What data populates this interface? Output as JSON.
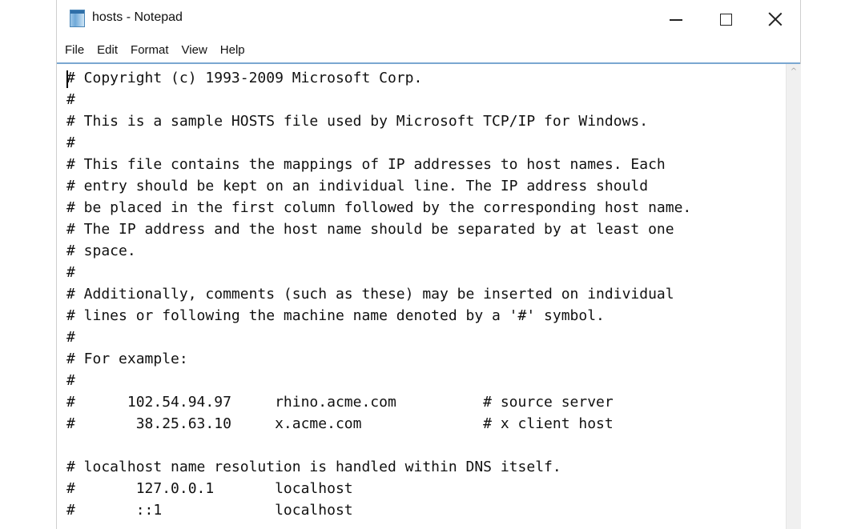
{
  "window": {
    "title": "hosts - Notepad",
    "app_icon": "notepad-icon"
  },
  "titlebar_buttons": {
    "minimize_icon": "minimize-icon",
    "maximize_icon": "maximize-icon",
    "close_icon": "close-icon"
  },
  "menu": {
    "items": [
      "File",
      "Edit",
      "Format",
      "View",
      "Help"
    ]
  },
  "editor": {
    "lines": [
      "# Copyright (c) 1993-2009 Microsoft Corp.",
      "#",
      "# This is a sample HOSTS file used by Microsoft TCP/IP for Windows.",
      "#",
      "# This file contains the mappings of IP addresses to host names. Each",
      "# entry should be kept on an individual line. The IP address should",
      "# be placed in the first column followed by the corresponding host name.",
      "# The IP address and the host name should be separated by at least one",
      "# space.",
      "#",
      "# Additionally, comments (such as these) may be inserted on individual",
      "# lines or following the machine name denoted by a '#' symbol.",
      "#",
      "# For example:",
      "#",
      "#      102.54.94.97     rhino.acme.com          # source server",
      "#       38.25.63.10     x.acme.com              # x client host",
      "",
      "# localhost name resolution is handled within DNS itself.",
      "#       127.0.0.1       localhost",
      "#       ::1             localhost"
    ]
  },
  "scrollbar": {
    "up_arrow_icon": "scroll-up-arrow-icon",
    "up_arrow_glyph": "^"
  },
  "colors": {
    "menu_border": "#7aa7d1",
    "text": "#111111",
    "scrollbar_track": "#f0f0f0"
  }
}
